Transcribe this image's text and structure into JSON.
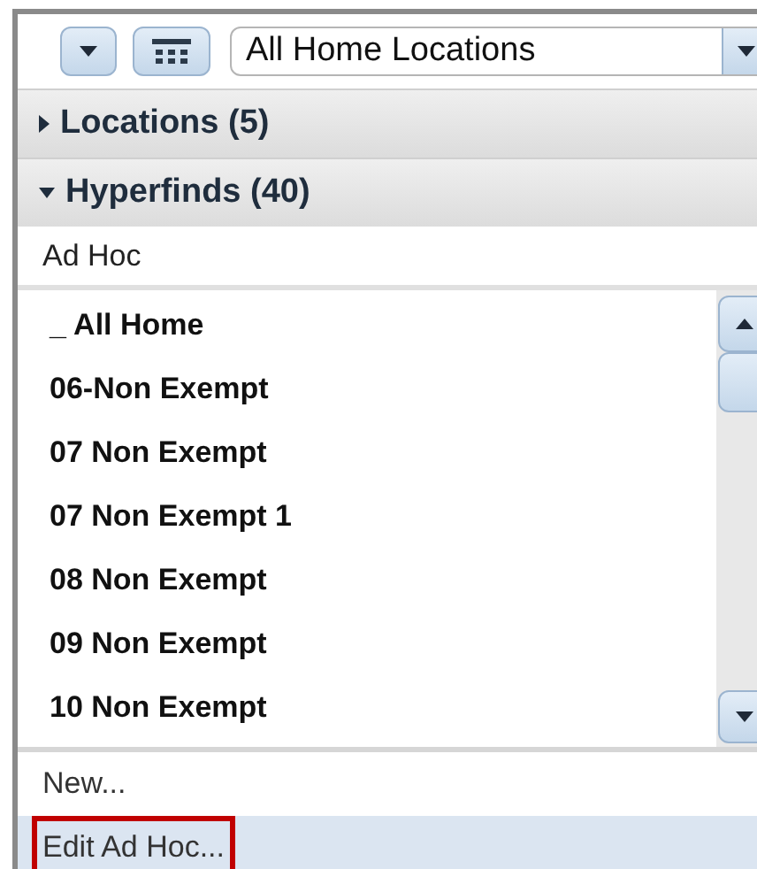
{
  "toolbar": {
    "location_select": {
      "value": "All Home Locations"
    }
  },
  "sections": [
    {
      "label": "Locations (5)",
      "expanded": false
    },
    {
      "label": "Hyperfinds (40)",
      "expanded": true
    }
  ],
  "group_label": "Ad Hoc",
  "list_items": [
    "_ All Home",
    "06-Non Exempt",
    "07 Non Exempt",
    "07 Non Exempt 1",
    "08 Non Exempt",
    "09 Non Exempt",
    "10 Non Exempt"
  ],
  "footer_items": [
    {
      "label": "New...",
      "selected": false,
      "highlighted": false
    },
    {
      "label": "Edit Ad Hoc...",
      "selected": true,
      "highlighted": true
    }
  ]
}
